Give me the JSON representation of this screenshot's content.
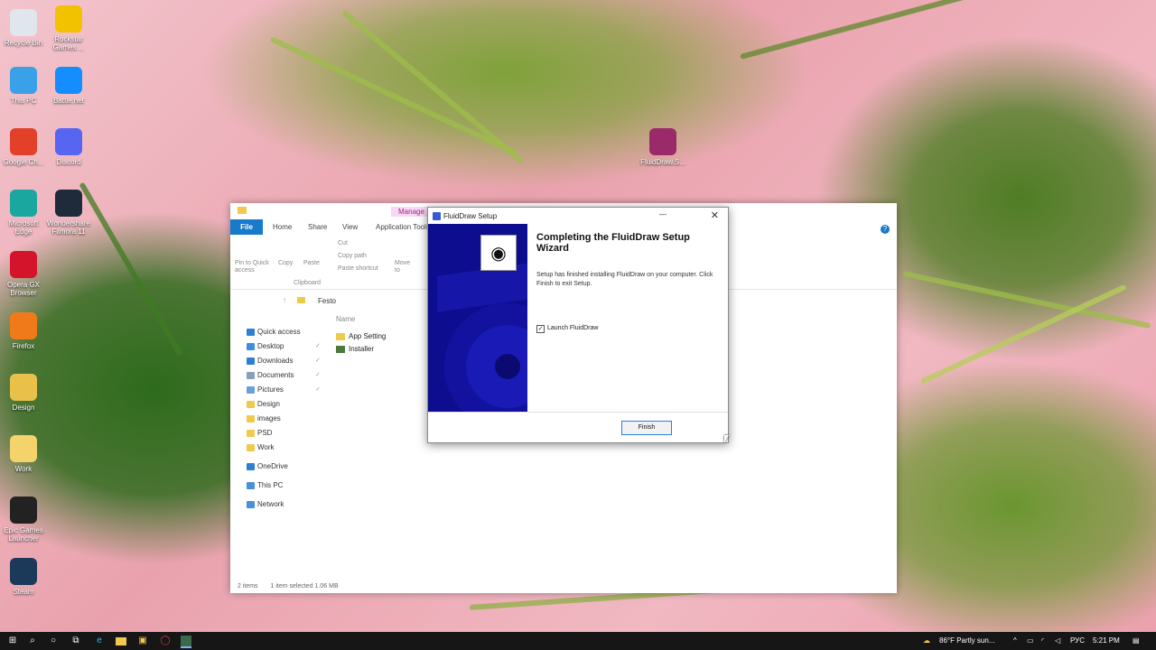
{
  "desktop": {
    "icons": [
      {
        "label": "Recycle Bin",
        "icon": "recycle-bin-icon",
        "color": "#dfe6ee"
      },
      {
        "label": "Rockstar Games ...",
        "icon": "rockstar-icon",
        "color": "#f2c200"
      },
      {
        "label": "This PC",
        "icon": "this-pc-icon",
        "color": "#3aa0e8"
      },
      {
        "label": "Battle.net",
        "icon": "battlenet-icon",
        "color": "#148eff"
      },
      {
        "label": "Google Ch...",
        "icon": "chrome-icon",
        "color": "#e3402a"
      },
      {
        "label": "Discord",
        "icon": "discord-icon",
        "color": "#5865f2"
      },
      {
        "label": "Microsoft Edge",
        "icon": "edge-icon",
        "color": "#1aa7a0"
      },
      {
        "label": "Wondershare Filmora 11",
        "icon": "filmora-icon",
        "color": "#1f2a3a"
      },
      {
        "label": "Opera GX Browser",
        "icon": "opera-icon",
        "color": "#d3142b"
      },
      {
        "label": "Firefox",
        "icon": "firefox-icon",
        "color": "#f07a1a"
      },
      {
        "label": "Design",
        "icon": "folder-icon",
        "color": "#e8c04a"
      },
      {
        "label": "Work",
        "icon": "folder-icon",
        "color": "#f3d36a"
      },
      {
        "label": "Epic Games Launcher",
        "icon": "epic-icon",
        "color": "#222222"
      },
      {
        "label": "Steam",
        "icon": "steam-icon",
        "color": "#1b3a5a"
      },
      {
        "label": "FluidDraw.S...",
        "icon": "winrar-icon",
        "color": "#9b2a6a"
      }
    ]
  },
  "explorer": {
    "manage_label": "Manage",
    "tabs": {
      "file": "File",
      "home": "Home",
      "share": "Share",
      "view": "View",
      "apptools": "Application Tools"
    },
    "ribbon": {
      "pin": "Pin to Quick access",
      "copy": "Copy",
      "paste": "Paste",
      "cut": "Cut",
      "copy_path": "Copy path",
      "paste_shortcut": "Paste shortcut",
      "move_to": "Move to",
      "group_clipboard": "Clipboard"
    },
    "address": {
      "path": "Festo"
    },
    "nav": [
      {
        "label": "Quick access",
        "color": "#2f7fd0"
      },
      {
        "label": "Desktop",
        "color": "#3a8fe0",
        "pinned": true
      },
      {
        "label": "Downloads",
        "color": "#2f7fd0",
        "pinned": true
      },
      {
        "label": "Documents",
        "color": "#8aa0b8",
        "pinned": true
      },
      {
        "label": "Pictures",
        "color": "#6aa0d8",
        "pinned": true
      },
      {
        "label": "Design",
        "color": "#f2c94c"
      },
      {
        "label": "images",
        "color": "#f2c94c"
      },
      {
        "label": "PSD",
        "color": "#f2c94c"
      },
      {
        "label": "Work",
        "color": "#f2c94c"
      },
      {
        "label": "OneDrive",
        "color": "#2f7fd0"
      },
      {
        "label": "This PC",
        "color": "#4a90d9"
      },
      {
        "label": "Network",
        "color": "#4a90d9"
      }
    ],
    "column_name": "Name",
    "files": [
      {
        "name": "App Setting",
        "color": "#f2c94c"
      },
      {
        "name": "Installer",
        "color": "#4a7a3a"
      }
    ],
    "status": {
      "items": "2 items",
      "selected": "1 item selected  1.06 MB"
    },
    "pin_glyph": "✓"
  },
  "setup": {
    "window_title": "FluidDraw Setup",
    "heading": "Completing the FluidDraw Setup Wizard",
    "description": "Setup has finished installing FluidDraw on your computer. Click Finish to exit Setup.",
    "checkbox_label": "Launch FluidDraw",
    "checkbox_checked": true,
    "finish_label": "Finish",
    "minimize_glyph": "—",
    "close_glyph": "✕"
  },
  "taskbar": {
    "weather": "86°F  Partly sun...",
    "language": "РУС",
    "time": "5:21 PM"
  }
}
